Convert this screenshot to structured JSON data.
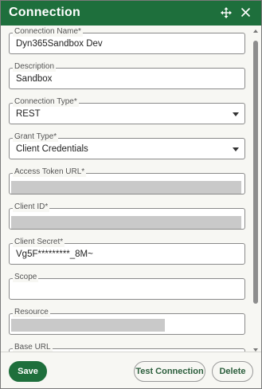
{
  "dialog": {
    "title": "Connection",
    "icons": {
      "move": "move-icon",
      "close": "close-icon"
    }
  },
  "form": {
    "connection_name": {
      "label": "Connection Name*",
      "value": "Dyn365Sandbox Dev"
    },
    "description": {
      "label": "Description",
      "value": "Sandbox"
    },
    "connection_type": {
      "label": "Connection Type*",
      "value": "REST"
    },
    "grant_type": {
      "label": "Grant Type*",
      "value": "Client Credentials"
    },
    "access_token_url": {
      "label": "Access Token URL*",
      "value": ""
    },
    "client_id": {
      "label": "Client ID*",
      "value": ""
    },
    "client_secret": {
      "label": "Client Secret*",
      "value": "Vg5F*********_8M~"
    },
    "scope": {
      "label": "Scope",
      "value": ""
    },
    "resource": {
      "label": "Resource",
      "value": ""
    },
    "base_url": {
      "label": "Base URL",
      "value": ""
    }
  },
  "footer": {
    "save_label": "Save",
    "test_label": "Test Connection",
    "delete_label": "Delete"
  },
  "colors": {
    "brand": "#1e6f3c",
    "redacted": "#c9c9c9"
  }
}
